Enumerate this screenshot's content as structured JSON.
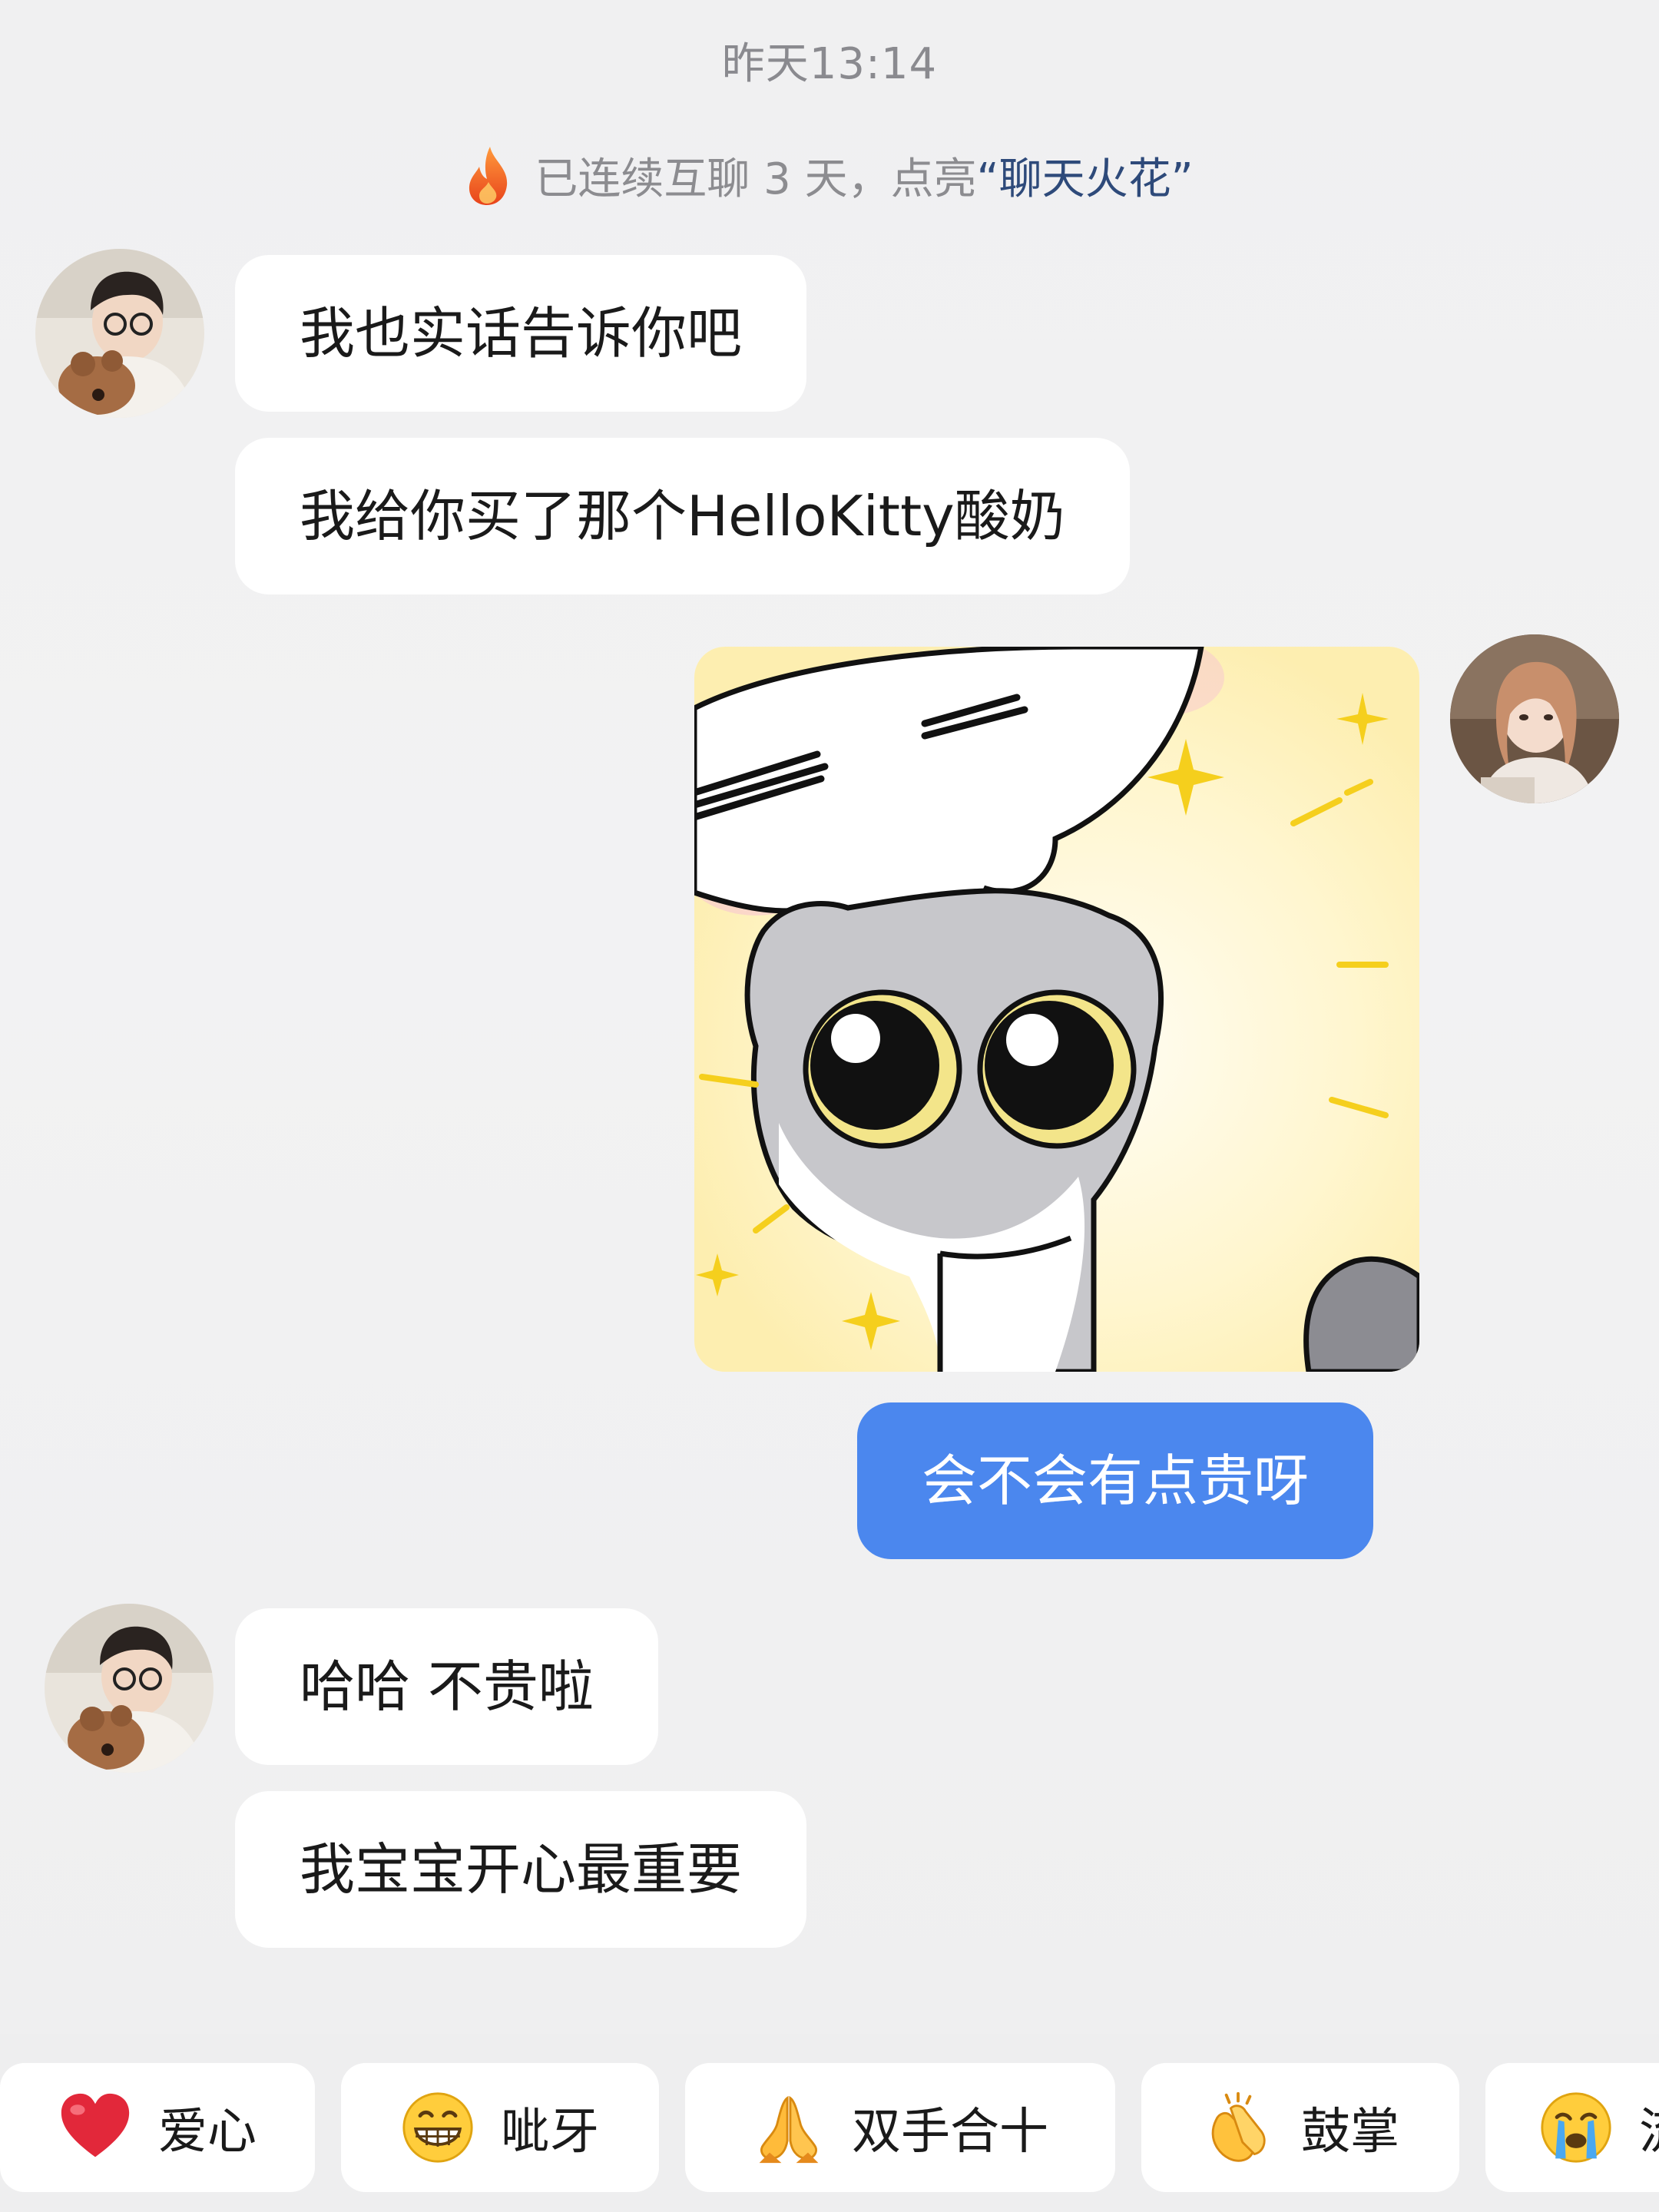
{
  "chat": {
    "timestamp": "昨天13:14",
    "streak": {
      "prefix": "已连续互聊 3 天，点亮",
      "highlight": "“聊天火花”"
    },
    "messages": [
      {
        "from": "other",
        "text": "我也实话告诉你吧"
      },
      {
        "from": "other",
        "text": "我给你买了那个HelloKitty酸奶"
      },
      {
        "from": "me",
        "type": "sticker",
        "icon": "cartoon-cat-sticker"
      },
      {
        "from": "me",
        "text": "会不会有点贵呀"
      },
      {
        "from": "other",
        "text": "哈哈 不贵啦"
      },
      {
        "from": "other",
        "text": "我宝宝开心最重要"
      }
    ]
  },
  "reactions": [
    {
      "icon": "red-heart-emoji",
      "label": "爱心"
    },
    {
      "icon": "grinning-emoji",
      "label": "呲牙"
    },
    {
      "icon": "folded-hands-emoji",
      "label": "双手合十"
    },
    {
      "icon": "clapping-hands-emoji",
      "label": "鼓掌"
    },
    {
      "icon": "crying-face-emoji",
      "label": "流"
    }
  ],
  "colors": {
    "my_bubble": "#4b87ee",
    "other_bubble": "#ffffff",
    "background": "#f1f1f2",
    "streak_highlight": "#2e4a7a"
  }
}
